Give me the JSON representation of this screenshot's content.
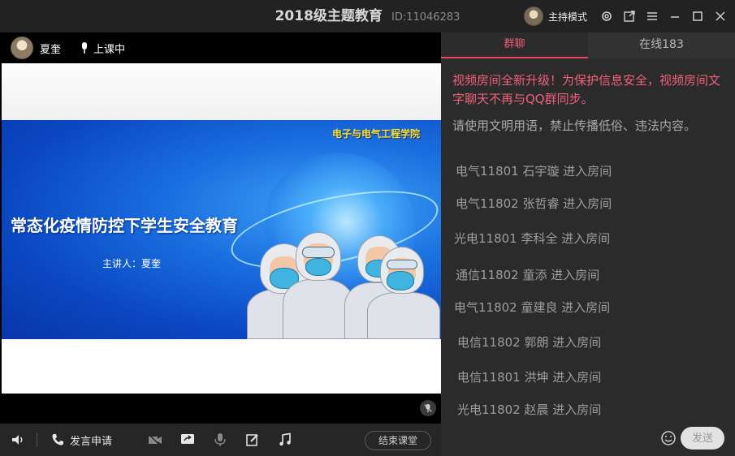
{
  "window": {
    "title": "2018级主题教育",
    "room_id": "ID:11046283",
    "host_mode_label": "主持模式"
  },
  "teacher": {
    "name": "夏奎",
    "status": "上课中"
  },
  "slide": {
    "college": "电子与电气工程学院",
    "title": "常态化疫情防控下学生安全教育",
    "speaker": "主讲人：夏奎"
  },
  "controls": {
    "speak_request_label": "发言申请",
    "end_class_label": "结束课堂"
  },
  "chat": {
    "tabs": [
      {
        "label": "群聊",
        "active": true
      },
      {
        "label": "在线183",
        "active": false
      }
    ],
    "notice": "视频房间全新升级！为保护信息安全，视频房间文字聊天不再与QQ群同步。",
    "rules": "请使用文明用语，禁止传播低俗、违法内容。",
    "messages": [
      "电气11801 石宇璇 进入房间",
      "电气11802 张哲睿 进入房间",
      "光电11801 李科全 进入房间",
      "通信11802 童添 进入房间",
      "电气11802 童建良 进入房间",
      "电信11802 郭朗 进入房间",
      "电信11801 洪坤 进入房间",
      "光电11802 赵晨 进入房间"
    ],
    "input_placeholder": "",
    "send_label": "发送"
  },
  "colors": {
    "accent_pink": "#e8465f",
    "notice_text": "#f0607a"
  }
}
